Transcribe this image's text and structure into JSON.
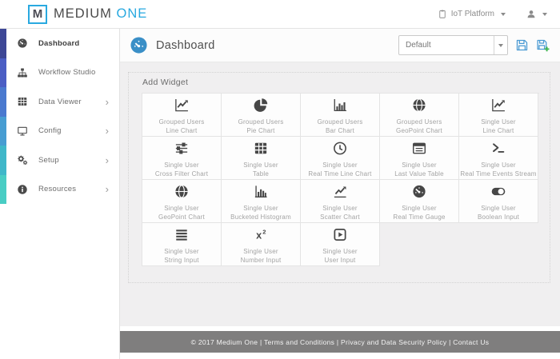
{
  "brand": {
    "mark": "M",
    "name": "MEDIUM",
    "accent": "ONE"
  },
  "top_bar": {
    "platform": {
      "label": "IoT Platform",
      "icon": "clipboard-icon"
    },
    "user_menu": {
      "icon": "user-icon"
    }
  },
  "sidebar": {
    "items": [
      {
        "label": "Dashboard",
        "icon": "dashboard-icon",
        "strip_color": "#3d4796",
        "active": true,
        "chevron": false
      },
      {
        "label": "Workflow Studio",
        "icon": "workflow-icon",
        "strip_color": "#4b5ec4",
        "active": false,
        "chevron": false
      },
      {
        "label": "Data Viewer",
        "icon": "table-icon",
        "strip_color": "#4a79cf",
        "active": false,
        "chevron": true
      },
      {
        "label": "Config",
        "icon": "desktop-icon",
        "strip_color": "#479dd2",
        "active": false,
        "chevron": true
      },
      {
        "label": "Setup",
        "icon": "gears-icon",
        "strip_color": "#3fb7c9",
        "active": false,
        "chevron": true
      },
      {
        "label": "Resources",
        "icon": "info-icon",
        "strip_color": "#49cdc4",
        "active": false,
        "chevron": true
      }
    ]
  },
  "main_header": {
    "title": "Dashboard",
    "icon": "dashboard-circle-icon",
    "dashboard_select": {
      "value": "Default"
    },
    "save_icon": "save-icon",
    "save_new_icon": "save-new-icon"
  },
  "panel": {
    "title": "Add Widget",
    "widgets": [
      {
        "group": "Grouped Users",
        "name": "Line Chart",
        "icon": "line-chart-icon"
      },
      {
        "group": "Grouped Users",
        "name": "Pie Chart",
        "icon": "pie-chart-icon"
      },
      {
        "group": "Grouped Users",
        "name": "Bar Chart",
        "icon": "bar-chart-icon"
      },
      {
        "group": "Grouped Users",
        "name": "GeoPoint Chart",
        "icon": "globe-icon"
      },
      {
        "group": "Single User",
        "name": "Line Chart",
        "icon": "line-chart-icon"
      },
      {
        "group": "Single User",
        "name": "Cross Filter Chart",
        "icon": "sliders-icon"
      },
      {
        "group": "Single User",
        "name": "Table",
        "icon": "table-grid-icon"
      },
      {
        "group": "Single User",
        "name": "Real Time Line Chart",
        "icon": "clock-icon"
      },
      {
        "group": "Single User",
        "name": "Last Value Table",
        "icon": "list-table-icon"
      },
      {
        "group": "Single User",
        "name": "Real Time Events Stream",
        "icon": "terminal-icon"
      },
      {
        "group": "Single User",
        "name": "GeoPoint Chart",
        "icon": "globe-icon"
      },
      {
        "group": "Single User",
        "name": "Bucketed Histogram",
        "icon": "histogram-icon"
      },
      {
        "group": "Single User",
        "name": "Scatter Chart",
        "icon": "scatter-chart-icon"
      },
      {
        "group": "Single User",
        "name": "Real Time Gauge",
        "icon": "gauge-icon"
      },
      {
        "group": "Single User",
        "name": "Boolean Input",
        "icon": "toggle-icon"
      },
      {
        "group": "Single User",
        "name": "String Input",
        "icon": "align-justify-icon"
      },
      {
        "group": "Single User",
        "name": "Number Input",
        "icon": "x-squared-icon"
      },
      {
        "group": "Single User",
        "name": "User Input",
        "icon": "play-square-icon"
      }
    ]
  },
  "footer": {
    "text": "© 2017 Medium One | Terms and Conditions | Privacy and Data Security Policy | Contact Us"
  },
  "colors": {
    "accent_blue": "#29a9e0",
    "header_icon_blue": "#3a8fc7",
    "save_blue": "#4a9ad3",
    "plus_green": "#3cb54a",
    "content_bg": "#f0eff0",
    "footer_bg": "#7f7e7e"
  }
}
